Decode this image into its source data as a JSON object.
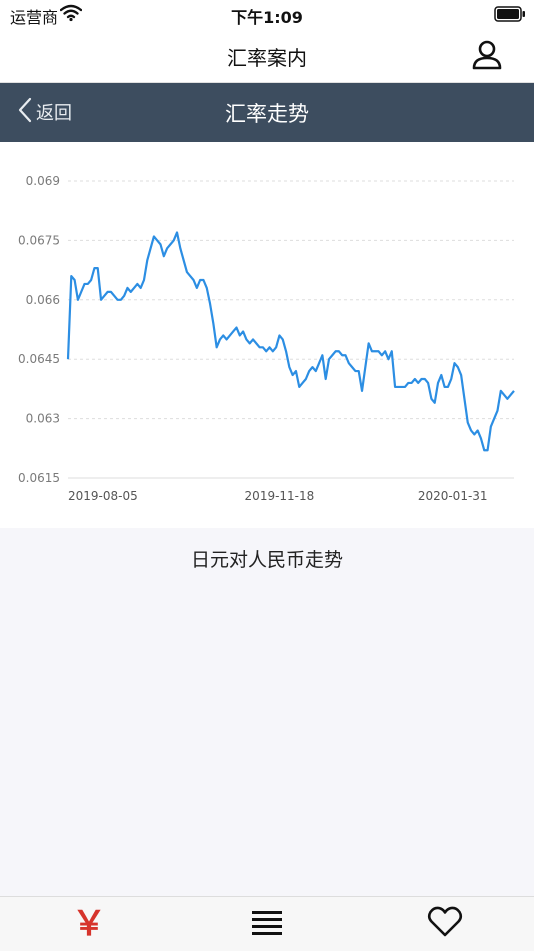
{
  "status_bar": {
    "carrier": "运营商",
    "time": "下午1:09",
    "wifi_icon": "wifi-icon",
    "battery_icon": "battery-icon"
  },
  "nav": {
    "title": "汇率案内",
    "user_icon": "user-icon"
  },
  "sub_header": {
    "back_label": "返回",
    "title": "汇率走势",
    "back_icon": "chevron-left-icon"
  },
  "chart_caption": "日元对人民币走势",
  "tabs": {
    "rate_glyph": "￥",
    "rate_color": "#d6342c",
    "list_icon": "list-icon",
    "fav_icon": "heart-icon"
  },
  "colors": {
    "header_bg": "#3d4d5f",
    "line": "#2c8ee3",
    "grid": "#dddddd"
  },
  "chart_data": {
    "type": "line",
    "title": "",
    "xlabel": "",
    "ylabel": "",
    "ylim": [
      0.0615,
      0.069
    ],
    "yticks": [
      "0.069",
      "0.0675",
      "0.066",
      "0.0645",
      "0.063",
      "0.0615"
    ],
    "yticks_values": [
      0.069,
      0.0675,
      0.066,
      0.0645,
      0.063,
      0.0615
    ],
    "xticks": [
      "2019-08-05",
      "2019-11-18",
      "2020-01-31"
    ],
    "xticks_index": [
      0,
      64,
      127
    ],
    "grid": true,
    "series": [
      {
        "values": [
          0.0645,
          0.0666,
          0.0665,
          0.066,
          0.0662,
          0.0664,
          0.0664,
          0.0665,
          0.0668,
          0.0668,
          0.066,
          0.0661,
          0.0662,
          0.0662,
          0.0661,
          0.066,
          0.066,
          0.0661,
          0.0663,
          0.0662,
          0.0663,
          0.0664,
          0.0663,
          0.0665,
          0.067,
          0.0673,
          0.0676,
          0.0675,
          0.0674,
          0.0671,
          0.0673,
          0.0674,
          0.0675,
          0.0677,
          0.0673,
          0.067,
          0.0667,
          0.0666,
          0.0665,
          0.0663,
          0.0665,
          0.0665,
          0.0663,
          0.0659,
          0.0654,
          0.0648,
          0.065,
          0.0651,
          0.065,
          0.0651,
          0.0652,
          0.0653,
          0.0651,
          0.0652,
          0.065,
          0.0649,
          0.065,
          0.0649,
          0.0648,
          0.0648,
          0.0647,
          0.0648,
          0.0647,
          0.0648,
          0.0651,
          0.065,
          0.0647,
          0.0643,
          0.0641,
          0.0642,
          0.0638,
          0.0639,
          0.064,
          0.0642,
          0.0643,
          0.0642,
          0.0644,
          0.0646,
          0.064,
          0.0645,
          0.0646,
          0.0647,
          0.0647,
          0.0646,
          0.0646,
          0.0644,
          0.0643,
          0.0642,
          0.0642,
          0.0637,
          0.0643,
          0.0649,
          0.0647,
          0.0647,
          0.0647,
          0.0646,
          0.0647,
          0.0645,
          0.0647,
          0.0638,
          0.0638,
          0.0638,
          0.0638,
          0.0639,
          0.0639,
          0.064,
          0.0639,
          0.064,
          0.064,
          0.0639,
          0.0635,
          0.0634,
          0.0639,
          0.0641,
          0.0638,
          0.0638,
          0.064,
          0.0644,
          0.0643,
          0.0641,
          0.0635,
          0.0629,
          0.0627,
          0.0626,
          0.0627,
          0.0625,
          0.0622,
          0.0622,
          0.0628,
          0.063,
          0.0632,
          0.0637,
          0.0636,
          0.0635,
          0.0636,
          0.0637
        ]
      }
    ]
  }
}
